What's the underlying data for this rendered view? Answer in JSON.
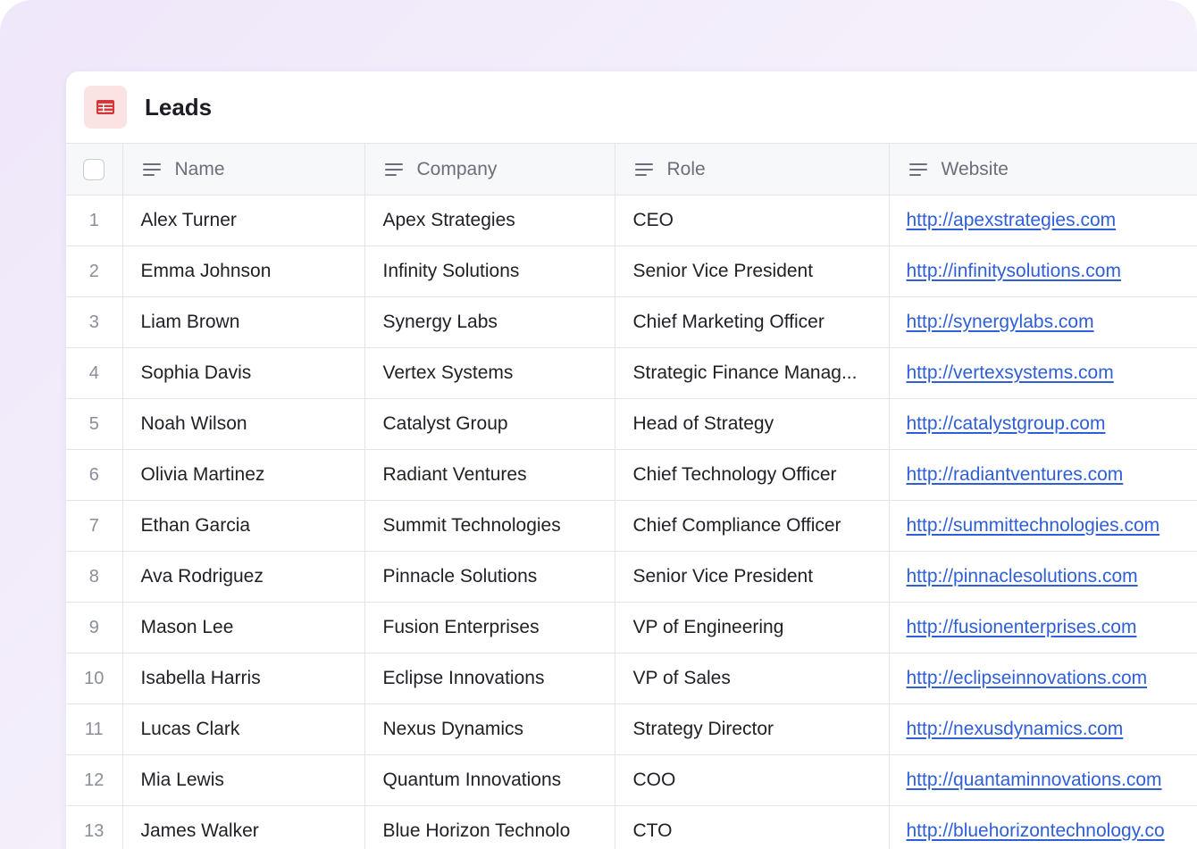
{
  "sheet": {
    "title": "Leads",
    "icon": "table-icon",
    "accent_color": "#d6353a"
  },
  "columns": [
    {
      "label": "Name",
      "icon": "text-lines-icon"
    },
    {
      "label": "Company",
      "icon": "text-lines-icon"
    },
    {
      "label": "Role",
      "icon": "text-lines-icon"
    },
    {
      "label": "Website",
      "icon": "text-lines-icon"
    }
  ],
  "rows": [
    {
      "index": "1",
      "name": "Alex Turner",
      "company": "Apex Strategies",
      "role": "CEO",
      "website": "http://apexstrategies.com"
    },
    {
      "index": "2",
      "name": "Emma Johnson",
      "company": "Infinity Solutions",
      "role": "Senior Vice President",
      "website": "http://infinitysolutions.com"
    },
    {
      "index": "3",
      "name": "Liam Brown",
      "company": "Synergy Labs",
      "role": "Chief Marketing Officer",
      "website": "http://synergylabs.com"
    },
    {
      "index": "4",
      "name": "Sophia Davis",
      "company": "Vertex Systems",
      "role": "Strategic Finance Manag...",
      "website": "http://vertexsystems.com"
    },
    {
      "index": "5",
      "name": "Noah Wilson",
      "company": "Catalyst Group",
      "role": "Head of Strategy",
      "website": "http://catalystgroup.com"
    },
    {
      "index": "6",
      "name": "Olivia Martinez",
      "company": "Radiant Ventures",
      "role": "Chief Technology Officer",
      "website": "http://radiantventures.com"
    },
    {
      "index": "7",
      "name": "Ethan Garcia",
      "company": "Summit Technologies",
      "role": "Chief Compliance Officer",
      "website": "http://summittechnologies.com"
    },
    {
      "index": "8",
      "name": "Ava Rodriguez",
      "company": "Pinnacle Solutions",
      "role": "Senior Vice President",
      "website": "http://pinnaclesolutions.com"
    },
    {
      "index": "9",
      "name": "Mason Lee",
      "company": "Fusion Enterprises",
      "role": "VP of Engineering",
      "website": "http://fusionenterprises.com"
    },
    {
      "index": "10",
      "name": "Isabella Harris",
      "company": "Eclipse Innovations",
      "role": "VP of Sales",
      "website": "http://eclipseinnovations.com"
    },
    {
      "index": "11",
      "name": "Lucas Clark",
      "company": "Nexus Dynamics",
      "role": "Strategy Director",
      "website": "http://nexusdynamics.com"
    },
    {
      "index": "12",
      "name": "Mia Lewis",
      "company": "Quantum Innovations",
      "role": "COO",
      "website": "http://quantaminnovations.com"
    },
    {
      "index": "13",
      "name": "James Walker",
      "company": "Blue Horizon Technolo",
      "role": "CTO",
      "website": "http://bluehorizontechnology.co"
    }
  ]
}
